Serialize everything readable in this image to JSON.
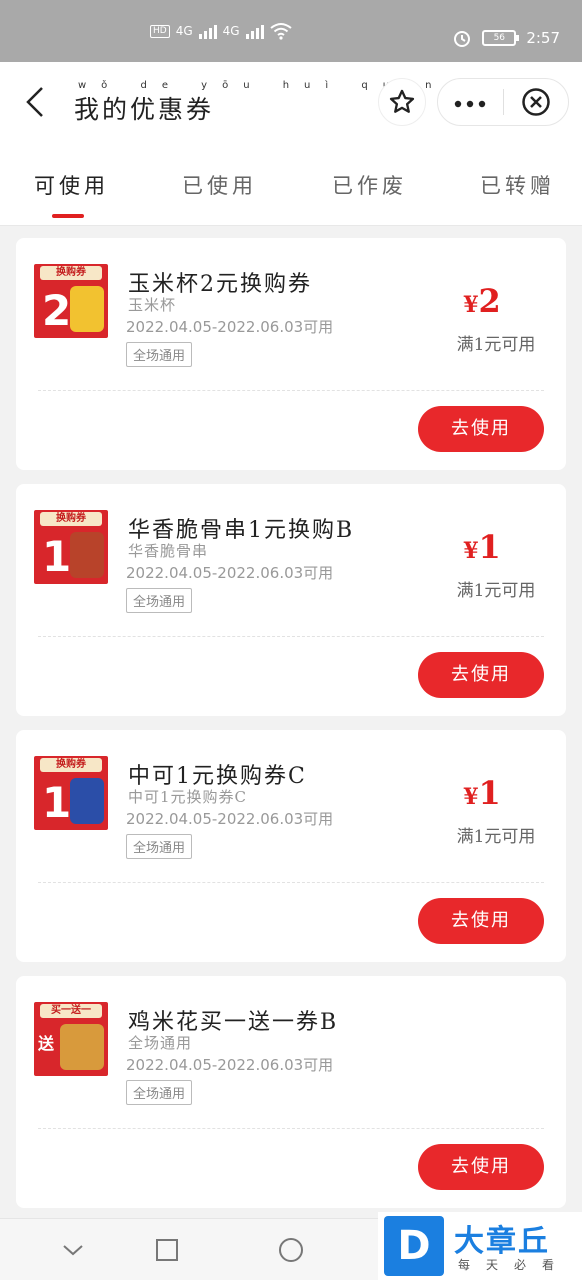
{
  "status_bar": {
    "network_1": "4G",
    "network_2": "4G",
    "battery": "56",
    "time": "2:57"
  },
  "header": {
    "title": "我的优惠券",
    "title_pinyin": "wǒ de yōu huì quàn"
  },
  "tabs": [
    {
      "label": "可使用",
      "active": true
    },
    {
      "label": "已使用",
      "active": false
    },
    {
      "label": "已作废",
      "active": false
    },
    {
      "label": "已转赠",
      "active": false
    }
  ],
  "coupons": [
    {
      "badge": "换购券",
      "badge_value": "2",
      "title": "玉米杯2元换购券",
      "subtitle": "玉米杯",
      "validity": "2022.04.05-2022.06.03可用",
      "scope": "全场通用",
      "amount": "2",
      "currency": "¥",
      "condition": "满1元可用",
      "button": "去使用",
      "image_color": "#f2c230"
    },
    {
      "badge": "换购券",
      "badge_value": "1",
      "title": "华香脆骨串1元换购B",
      "subtitle": "华香脆骨串",
      "validity": "2022.04.05-2022.06.03可用",
      "scope": "全场通用",
      "amount": "1",
      "currency": "¥",
      "condition": "满1元可用",
      "button": "去使用",
      "image_color": "#b8432a"
    },
    {
      "badge": "换购券",
      "badge_value": "1",
      "title": "中可1元换购券C",
      "subtitle": "中可1元换购券C",
      "validity": "2022.04.05-2022.06.03可用",
      "scope": "全场通用",
      "amount": "1",
      "currency": "¥",
      "condition": "满1元可用",
      "button": "去使用",
      "image_color": "#2b4ea8"
    },
    {
      "badge": "买一送一",
      "badge_value": "送",
      "title": "鸡米花买一送一券B",
      "subtitle": "全场通用",
      "validity": "2022.04.05-2022.06.03可用",
      "scope": "全场通用",
      "amount": "",
      "currency": "",
      "condition": "",
      "button": "去使用",
      "image_color": "#d89a3c"
    }
  ],
  "watermark": {
    "logo": "D",
    "name": "大章丘",
    "slogan": "每天必看"
  },
  "colors": {
    "accent": "#e02020",
    "button": "#e8282b",
    "status_bar": "#a9a9a9",
    "watermark_blue": "#1b7fe0"
  }
}
